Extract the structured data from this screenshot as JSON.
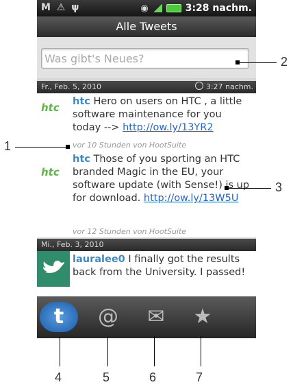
{
  "statusbar": {
    "left_icons": "M ⚠ ψ",
    "time": "3:28 nachm."
  },
  "titlebar": {
    "title": "Alle Tweets"
  },
  "search": {
    "placeholder": "Was gibt's Neues?"
  },
  "groups": [
    {
      "date": "Fr., Feb. 5, 2010",
      "refresh_time": "3:27 nachm."
    },
    {
      "date": "Mi., Feb. 3, 2010"
    }
  ],
  "tweets": [
    {
      "avatar": "htc",
      "user": "htc",
      "text": " Hero on users on HTC , a little software maintenance for you today -->",
      "link": "http://ow.ly/13YR2",
      "meta": "vor 10 Stunden von HootSuite"
    },
    {
      "avatar": "htc",
      "user": "htc",
      "text": " Those of you sporting an HTC branded Magic in the EU, your software update (with Sense!) is up for download.",
      "link": "http://ow.ly/13W5U",
      "meta": "vor 12 Stunden von HootSuite"
    },
    {
      "avatar": "twitter",
      "user": "lauralee0",
      "text": " I finally got the results back from the University. I passed!"
    }
  ],
  "tabs": [
    {
      "icon": "twitter-t-icon",
      "glyph": "t"
    },
    {
      "icon": "at-icon",
      "glyph": "@"
    },
    {
      "icon": "envelope-icon",
      "glyph": "✉"
    },
    {
      "icon": "star-icon",
      "glyph": "★"
    }
  ],
  "callouts": [
    "1",
    "2",
    "3",
    "4",
    "5",
    "6",
    "7"
  ]
}
